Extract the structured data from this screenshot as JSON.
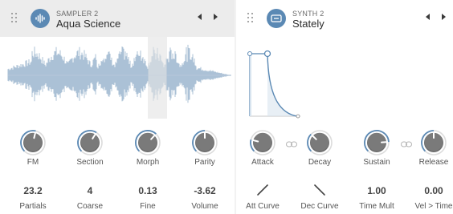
{
  "sampler": {
    "subtitle": "SAMPLER 2",
    "title": "Aqua Science",
    "icon": "waveform-icon",
    "accent": "#5b89b4",
    "knobs": [
      {
        "label": "FM",
        "level": 0.55
      },
      {
        "label": "Section",
        "level": 0.62
      },
      {
        "label": "Morph",
        "level": 0.66
      },
      {
        "label": "Parity",
        "level": 0.5
      }
    ],
    "values": [
      {
        "value": "23.2",
        "label": "Partials"
      },
      {
        "value": "4",
        "label": "Coarse"
      },
      {
        "value": "0.13",
        "label": "Fine"
      },
      {
        "value": "-3.62",
        "label": "Volume"
      }
    ]
  },
  "synth": {
    "subtitle": "SYNTH 2",
    "title": "Stately",
    "icon": "synth-icon",
    "accent": "#5b89b4",
    "knobs": [
      {
        "label": "Attack",
        "level": 0.22
      },
      {
        "label": "Decay",
        "level": 0.33
      },
      {
        "label": "Sustain",
        "level": 0.82
      },
      {
        "label": "Release",
        "level": 0.5
      }
    ],
    "values": [
      {
        "value": "",
        "label": "Att Curve",
        "icon": "linear-curve-icon"
      },
      {
        "value": "",
        "label": "Dec Curve",
        "icon": "linear-curve-icon"
      },
      {
        "value": "1.00",
        "label": "Time Mult"
      },
      {
        "value": "0.00",
        "label": "Vel > Time"
      }
    ]
  }
}
